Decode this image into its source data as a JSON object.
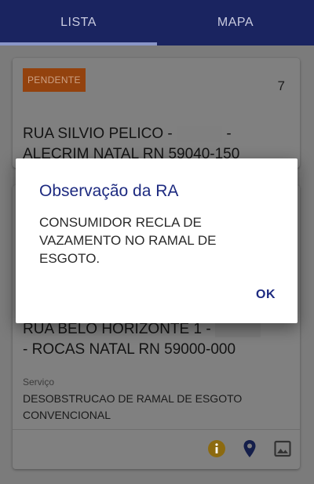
{
  "tabs": {
    "lista": "LISTA",
    "mapa": "MAPA"
  },
  "cards": [
    {
      "status": "PENDENTE",
      "count": "7",
      "address_line1_prefix": "RUA SILVIO PELICO -",
      "address_line1_suffix": "-",
      "address_line2": "ALECRIM NATAL RN 59040-150"
    },
    {
      "address_line1": "RUA BELO HORIZONTE 1 -",
      "address_line2": "- ROCAS NATAL RN 59000-000",
      "service_label": "Serviço",
      "service_value": "DESOBSTRUCAO DE RAMAL DE ESGOTO CONVENCIONAL"
    }
  ],
  "dialog": {
    "title": "Observação da RA",
    "body": "CONSUMIDOR RECLA DE VAZAMENTO NO RAMAL DE ESGOTO.",
    "ok_label": "OK"
  },
  "icons": {
    "info": "info-icon",
    "pin": "location-pin-icon",
    "gallery": "image-gallery-icon"
  },
  "colors": {
    "primary": "#1d2a80",
    "status_pending": "#e9661a",
    "info_icon": "#f2a400"
  }
}
